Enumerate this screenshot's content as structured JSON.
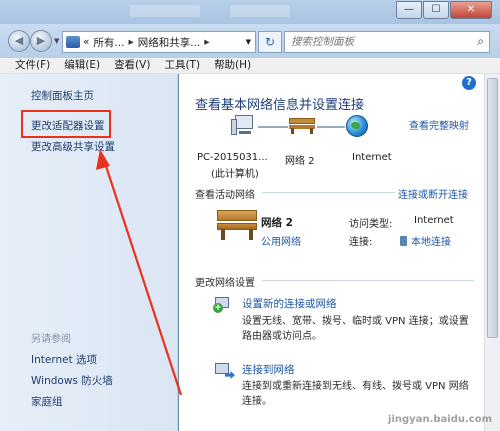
{
  "window": {
    "buttons": {
      "minimize": "—",
      "maximize": "☐",
      "close": "✕"
    }
  },
  "navbar": {
    "back_icon": "back-arrow-icon",
    "address_path": [
      "所有...",
      "网络和共享..."
    ],
    "address_prefix": "«",
    "search_placeholder": "搜索控制面板"
  },
  "menubar": {
    "items": [
      "文件(F)",
      "编辑(E)",
      "查看(V)",
      "工具(T)",
      "帮助(H)"
    ]
  },
  "sidebar": {
    "home": "控制面板主页",
    "adapter": "更改适配器设置",
    "advanced_sharing": "更改高级共享设置",
    "see_also_title": "另请参阅",
    "see_also": [
      "Internet 选项",
      "Windows 防火墙",
      "家庭组"
    ]
  },
  "main": {
    "title": "查看基本网络信息并设置连接",
    "full_map": "查看完整映射",
    "map_nodes": {
      "computer": "PC-2015031...",
      "computer_sub": "(此计算机)",
      "network": "网络  2",
      "internet": "Internet"
    },
    "active_networks": {
      "title": "查看活动网络",
      "connect_link": "连接或断开连接",
      "network_name": "网络  2",
      "network_type": "公用网络",
      "access_type_label": "访问类型:",
      "access_type_value": "Internet",
      "connection_label": "连接:",
      "connection_value": "本地连接"
    },
    "change_settings": {
      "title": "更改网络设置",
      "tasks": [
        {
          "link": "设置新的连接或网络",
          "desc": "设置无线、宽带、拨号、临时或 VPN 连接；或设置路由器或访问点。"
        },
        {
          "link": "连接到网络",
          "desc": "连接到或重新连接到无线、有线、拨号或 VPN 网络连接。"
        }
      ]
    }
  },
  "watermark": "jingyan.baidu.com",
  "colors": {
    "annotation_red": "#e8321e",
    "link_blue": "#1e56a8",
    "title_blue": "#1e3e78"
  }
}
